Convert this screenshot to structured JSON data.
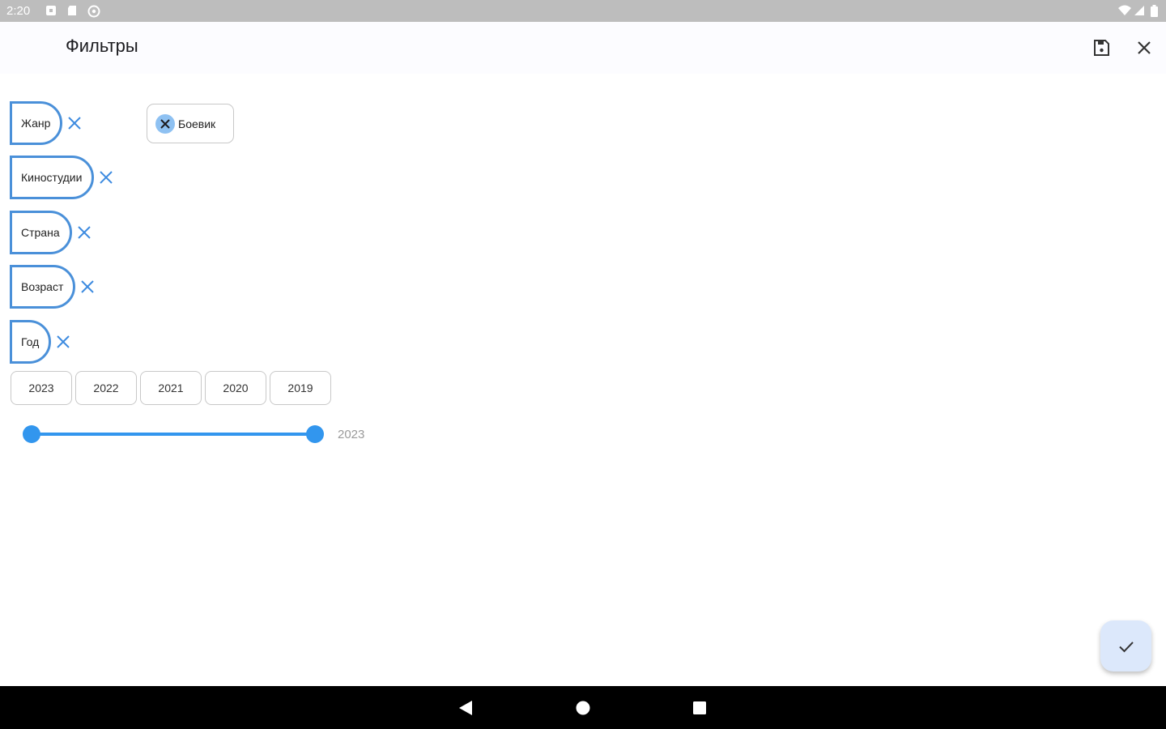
{
  "status_bar": {
    "time": "2:20",
    "left_icons": [
      "notification-icon",
      "sd-card-icon",
      "at-sign-icon"
    ],
    "right_icons": [
      "wifi-icon",
      "signal-icon",
      "battery-icon"
    ]
  },
  "app_bar": {
    "title": "Фильтры",
    "actions": [
      "save-icon",
      "close-icon"
    ]
  },
  "filters": [
    {
      "label": "Жанр"
    },
    {
      "label": "Киностудии"
    },
    {
      "label": "Страна"
    },
    {
      "label": "Возраст"
    },
    {
      "label": "Год"
    }
  ],
  "selected_genre": {
    "label": "Боевик"
  },
  "years": [
    "2023",
    "2022",
    "2021",
    "2020",
    "2019"
  ],
  "year_slider": {
    "value_text": "2023"
  },
  "colors": {
    "accent": "#3296ee",
    "tag_border": "#4a90d9",
    "fab_bg": "#dce8fb"
  },
  "nav_bar": {
    "buttons": [
      "back-icon",
      "home-icon",
      "recents-icon"
    ]
  }
}
